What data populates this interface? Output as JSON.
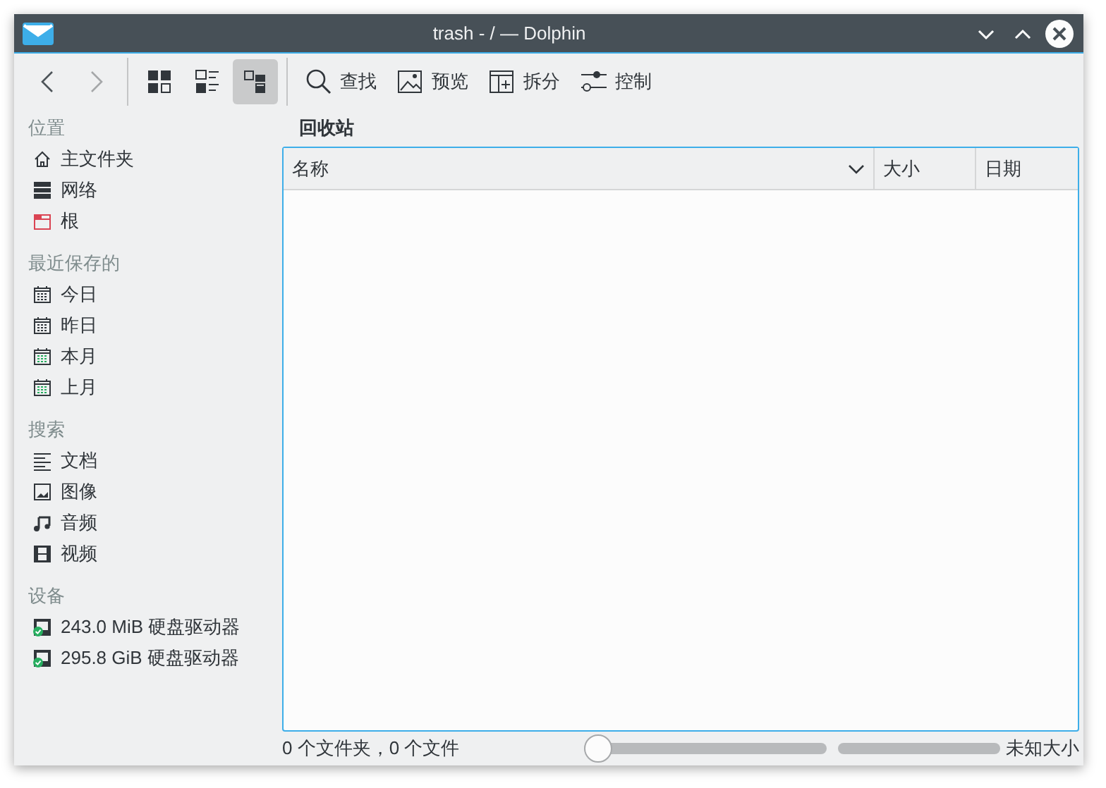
{
  "window": {
    "title": "trash - / — Dolphin"
  },
  "toolbar": {
    "back": {
      "disabled": false
    },
    "forward": {
      "disabled": true
    },
    "view_modes": [
      {
        "kind": "icons",
        "selected": false
      },
      {
        "kind": "compact",
        "selected": false
      },
      {
        "kind": "details",
        "selected": true
      }
    ],
    "actions": [
      {
        "kind": "search",
        "label": "查找"
      },
      {
        "kind": "preview",
        "label": "预览"
      },
      {
        "kind": "split",
        "label": "拆分"
      },
      {
        "kind": "control",
        "label": "控制"
      }
    ]
  },
  "sidebar": [
    {
      "heading": "位置",
      "items": [
        {
          "kind": "home",
          "label": "主文件夹"
        },
        {
          "kind": "network",
          "label": "网络"
        },
        {
          "kind": "root",
          "label": "根"
        }
      ]
    },
    {
      "heading": "最近保存的",
      "items": [
        {
          "kind": "calendar",
          "label": "今日"
        },
        {
          "kind": "calendar",
          "label": "昨日"
        },
        {
          "kind": "calendar-green",
          "label": "本月"
        },
        {
          "kind": "calendar-green",
          "label": "上月"
        }
      ]
    },
    {
      "heading": "搜索",
      "items": [
        {
          "kind": "document",
          "label": "文档"
        },
        {
          "kind": "image",
          "label": "图像"
        },
        {
          "kind": "audio",
          "label": "音频"
        },
        {
          "kind": "video",
          "label": "视频"
        }
      ]
    },
    {
      "heading": "设备",
      "items": [
        {
          "kind": "drive",
          "label": "243.0 MiB 硬盘驱动器"
        },
        {
          "kind": "drive",
          "label": "295.8 GiB 硬盘驱动器"
        }
      ]
    }
  ],
  "location": "回收站",
  "table": {
    "columns": [
      {
        "label": "名称",
        "sorted": true
      },
      {
        "label": "大小",
        "sorted": false
      },
      {
        "label": "日期",
        "sorted": false
      }
    ]
  },
  "status_bar": {
    "summary": "0 个文件夹，0 个文件",
    "zoom": {
      "level": 0
    },
    "free_space": "未知大小"
  }
}
